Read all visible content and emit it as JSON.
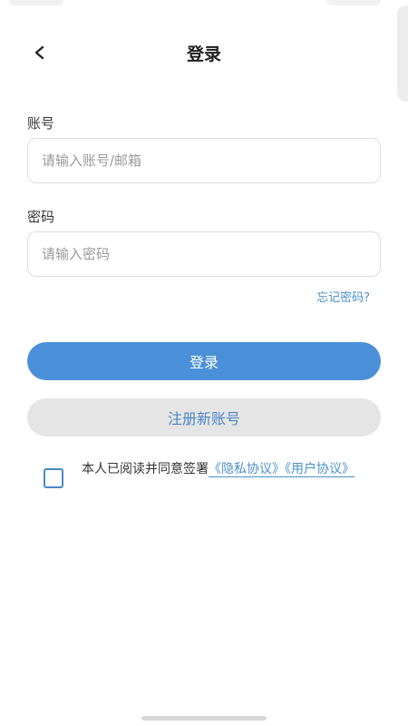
{
  "header": {
    "title": "登录",
    "back_icon": "chevron-left-icon"
  },
  "form": {
    "account": {
      "label": "账号",
      "placeholder": "请输入账号/邮箱",
      "value": ""
    },
    "password": {
      "label": "密码",
      "placeholder": "请输入密码",
      "value": ""
    },
    "forgot_label": "忘记密码?"
  },
  "buttons": {
    "login_label": "登录",
    "register_label": "注册新账号"
  },
  "agreement": {
    "checked": false,
    "prefix": "本人已阅读并同意签署",
    "privacy_link": "《隐私协议》",
    "user_link": "《用户协议》"
  },
  "colors": {
    "primary": "#4a90d9",
    "link": "#4a90c8",
    "secondary_bg": "#e5e5e5",
    "secondary_text": "#4a86c5"
  }
}
